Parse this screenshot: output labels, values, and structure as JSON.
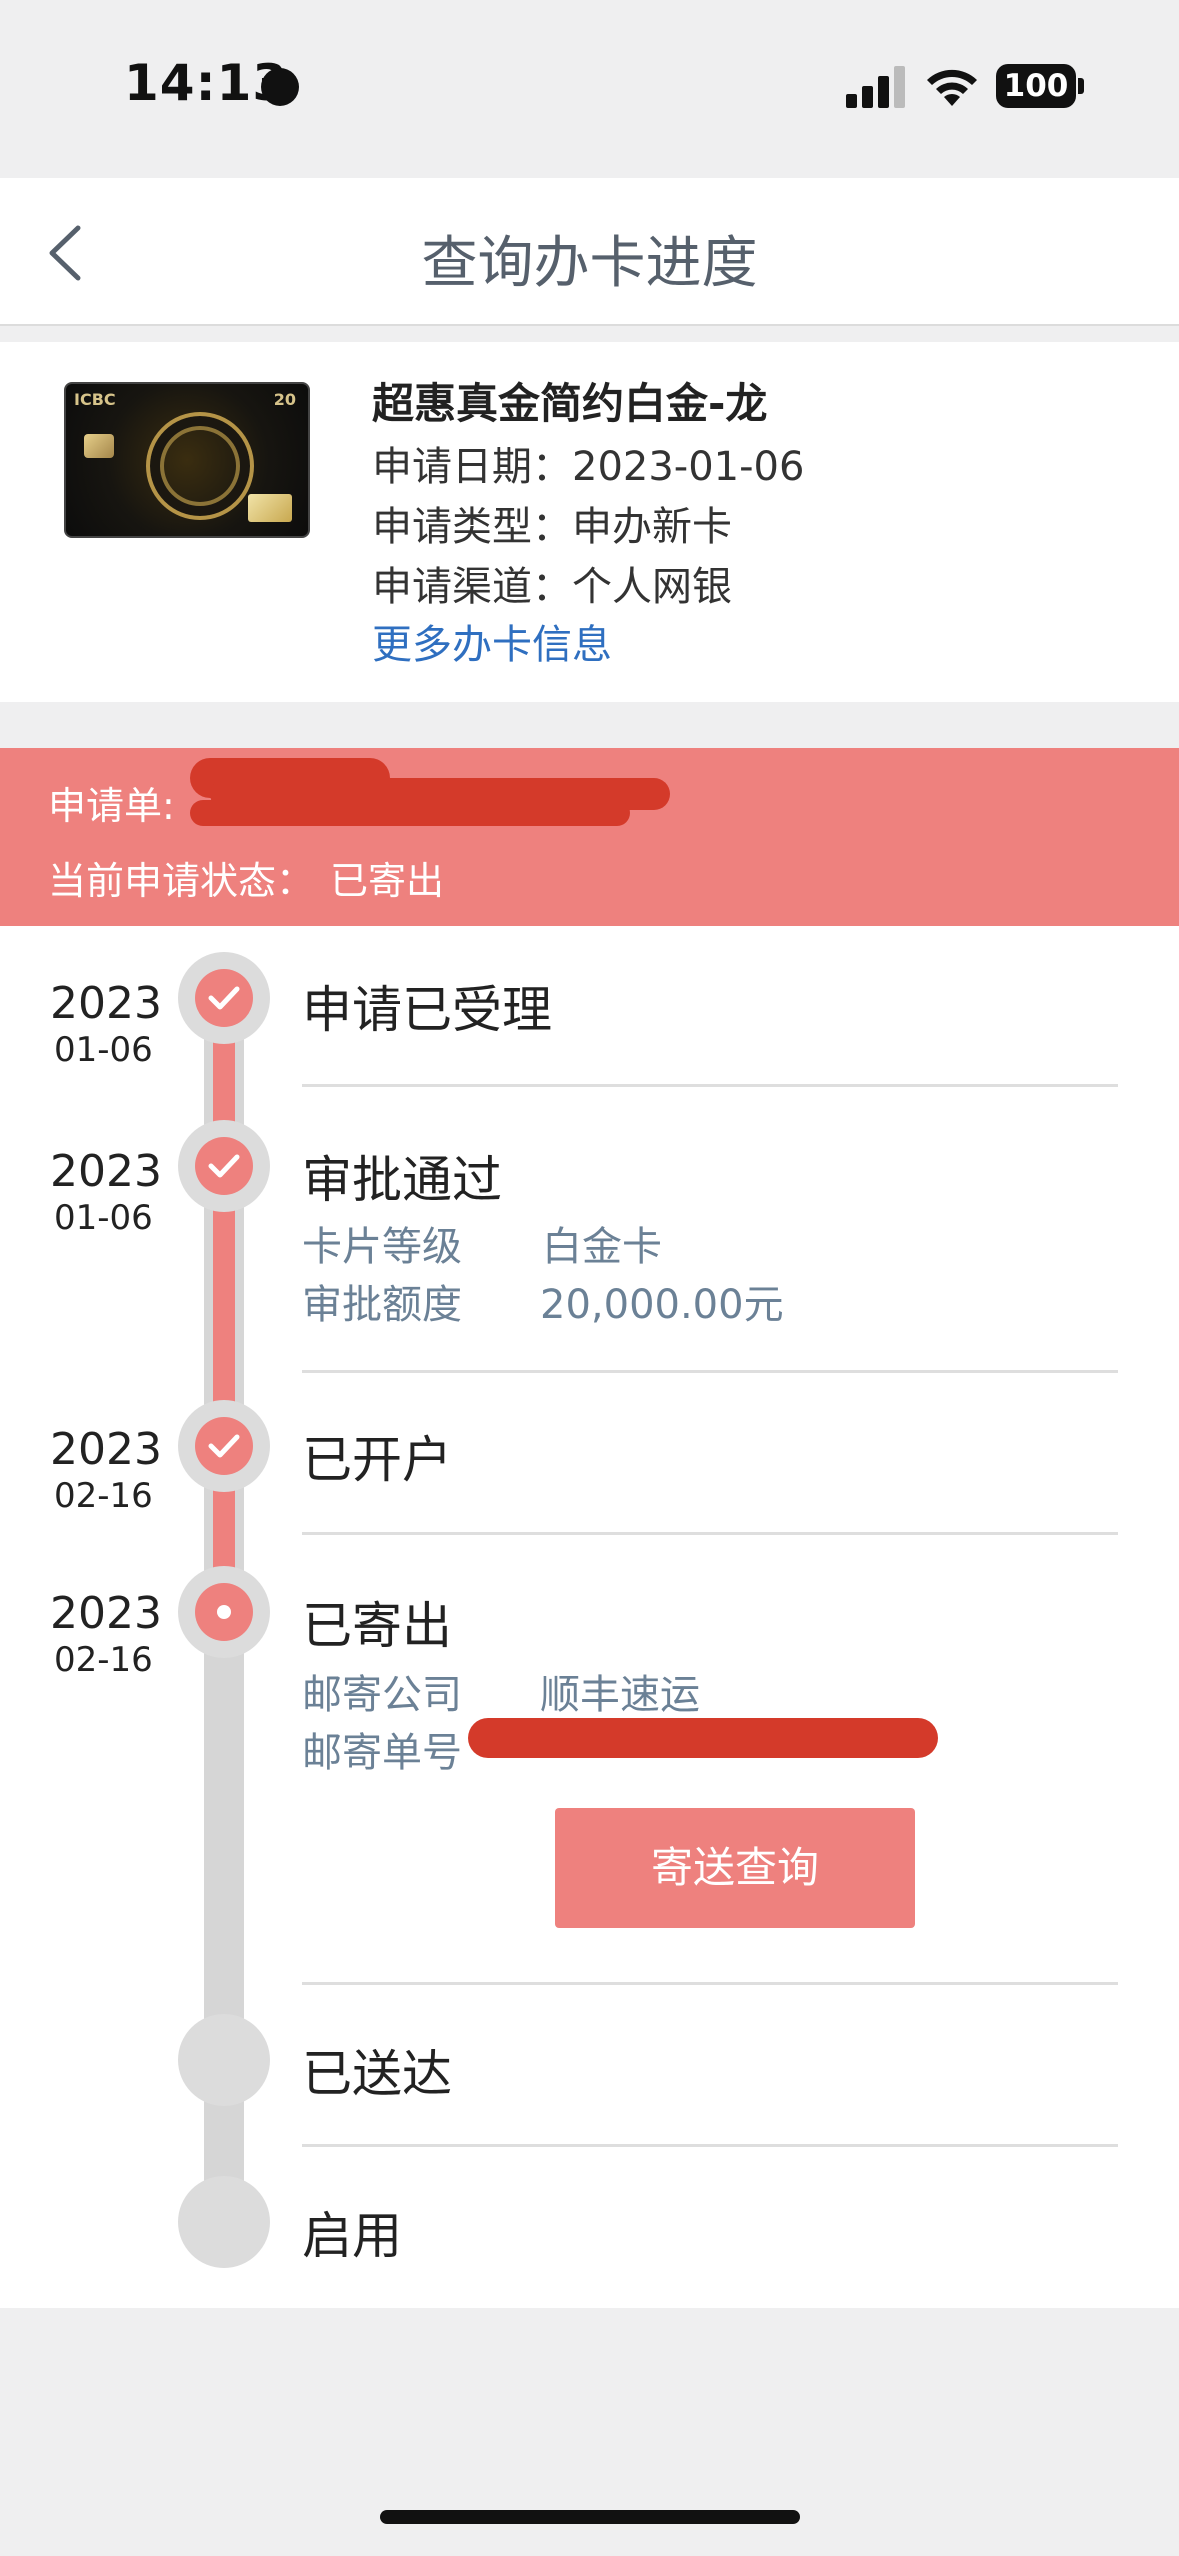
{
  "status_bar": {
    "time": "14:13",
    "battery": "100"
  },
  "nav": {
    "title": "查询办卡进度"
  },
  "card": {
    "logo": "ICBC",
    "number_badge": "20",
    "name": "超惠真金简约白金-龙",
    "apply_date": "申请日期：2023-01-06",
    "apply_type": "申请类型：申办新卡",
    "apply_channel": "申请渠道：个人网银",
    "more_link": "更多办卡信息"
  },
  "banner": {
    "order_label": "申请单:",
    "status_label": "当前申请状态：",
    "status_value": "已寄出"
  },
  "timeline": {
    "steps": [
      {
        "year": "2023",
        "date": "01-06",
        "title": "申请已受理",
        "state": "done"
      },
      {
        "year": "2023",
        "date": "01-06",
        "title": "审批通过",
        "state": "done",
        "details": [
          {
            "label": "卡片等级",
            "value": "白金卡"
          },
          {
            "label": "审批额度",
            "value": "20,000.00元"
          }
        ]
      },
      {
        "year": "2023",
        "date": "02-16",
        "title": "已开户",
        "state": "done"
      },
      {
        "year": "2023",
        "date": "02-16",
        "title": "已寄出",
        "state": "current",
        "details": [
          {
            "label": "邮寄公司",
            "value": "顺丰速运"
          },
          {
            "label": "邮寄单号",
            "value": ""
          }
        ],
        "button": "寄送查询"
      },
      {
        "year": "",
        "date": "",
        "title": "已送达",
        "state": "pending"
      },
      {
        "year": "",
        "date": "",
        "title": "启用",
        "state": "pending"
      }
    ]
  },
  "colors": {
    "accent": "#ee817e",
    "link": "#2f6fc0",
    "redaction": "#d43a2a"
  }
}
